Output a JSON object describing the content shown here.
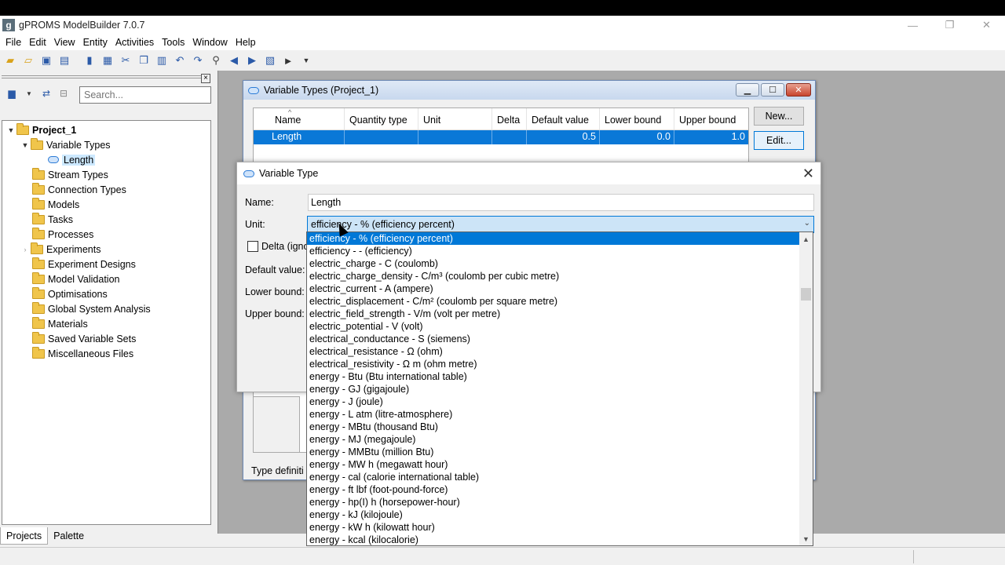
{
  "app": {
    "title": "gPROMS ModelBuilder 7.0.7",
    "logo_letter": "g",
    "window_controls": [
      "—",
      "❐",
      "✕"
    ]
  },
  "menu": [
    "File",
    "Edit",
    "View",
    "Entity",
    "Activities",
    "Tools",
    "Window",
    "Help"
  ],
  "search": {
    "placeholder": "Search..."
  },
  "tree": {
    "root": "Project_1",
    "variable_types": "Variable Types",
    "length": "Length",
    "folders": [
      "Stream Types",
      "Connection Types",
      "Models",
      "Tasks",
      "Processes",
      "Experiments",
      "Experiment Designs",
      "Model Validation",
      "Optimisations",
      "Global System Analysis",
      "Materials",
      "Saved Variable Sets",
      "Miscellaneous Files"
    ]
  },
  "left_tabs": [
    "Projects",
    "Palette"
  ],
  "vt_window": {
    "title": "Variable Types (Project_1)",
    "columns": [
      "Name",
      "Quantity type",
      "Unit",
      "Delta",
      "Default value",
      "Lower bound",
      "Upper bound"
    ],
    "row": {
      "name": "Length",
      "quantity_type": "",
      "unit": "",
      "delta": "",
      "default_value": "0.5",
      "lower_bound": "0.0",
      "upper_bound": "1.0"
    },
    "new_button": "New...",
    "edit_button": "Edit...",
    "type_definition": "Type definiti"
  },
  "dialog": {
    "title": "Variable Type",
    "name_label": "Name:",
    "name_value": "Length",
    "unit_label": "Unit:",
    "unit_value": "efficiency - % (efficiency percent)",
    "delta_label": "Delta (igno",
    "default_label": "Default value:",
    "lower_label": "Lower bound:",
    "upper_label": "Upper bound:"
  },
  "unit_options": [
    "efficiency - % (efficiency percent)",
    "efficiency - - (efficiency)",
    "electric_charge - C (coulomb)",
    "electric_charge_density - C/m³ (coulomb per cubic metre)",
    "electric_current - A (ampere)",
    "electric_displacement - C/m² (coulomb per square metre)",
    "electric_field_strength - V/m (volt per metre)",
    "electric_potential - V (volt)",
    "electrical_conductance - S (siemens)",
    "electrical_resistance - Ω (ohm)",
    "electrical_resistivity - Ω m (ohm metre)",
    "energy - Btu (Btu international table)",
    "energy - GJ (gigajoule)",
    "energy - J (joule)",
    "energy - L atm (litre-atmosphere)",
    "energy - MBtu (thousand Btu)",
    "energy - MJ (megajoule)",
    "energy - MMBtu (million Btu)",
    "energy - MW h (megawatt hour)",
    "energy - cal (calorie international table)",
    "energy - ft lbf (foot-pound-force)",
    "energy - hp(I) h (horsepower-hour)",
    "energy - kJ (kilojoule)",
    "energy - kW h (kilowatt hour)",
    "energy - kcal (kilocalorie)"
  ],
  "colors": {
    "selection": "#0078d7",
    "folder": "#f0c54b",
    "workspace": "#aaaaaa"
  }
}
